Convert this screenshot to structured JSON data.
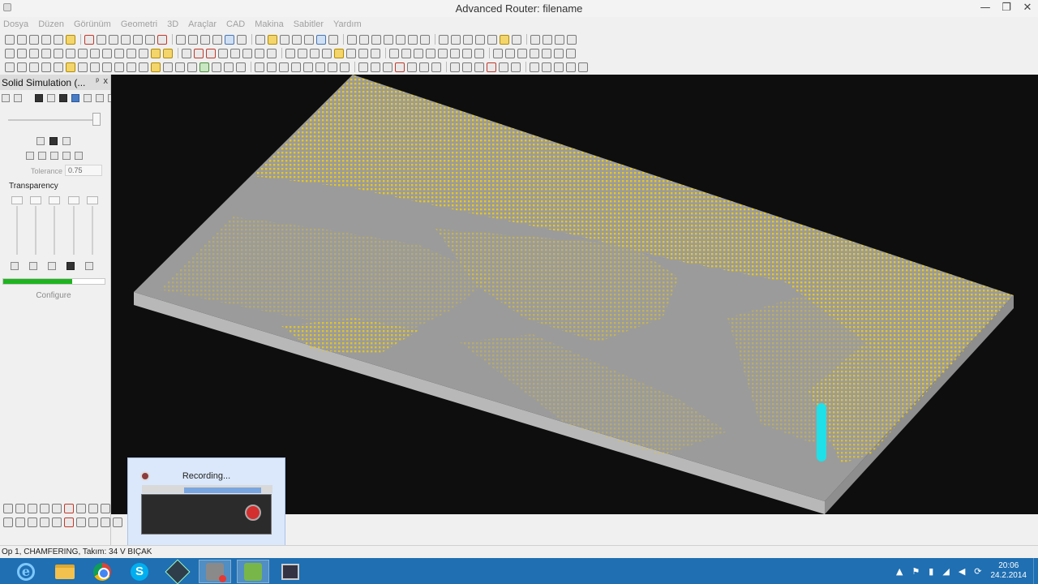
{
  "window": {
    "title": "Advanced Router: filename",
    "controls": {
      "minimize": "—",
      "restore": "❐",
      "close": "✕"
    }
  },
  "menu": [
    "Dosya",
    "Düzen",
    "Görünüm",
    "Geometri",
    "3D",
    "Araçlar",
    "CAD",
    "Makina",
    "Sabitler",
    "Yardım"
  ],
  "panel": {
    "title": "Solid Simulation (...",
    "pin": "ᵖ",
    "close": "x",
    "tolerance_label": "Tolerance",
    "tolerance_value": "0.75",
    "transparency_label": "Transparency",
    "progress_fraction": 0.68,
    "configure_label": "Configure"
  },
  "recording": {
    "label": "Recording..."
  },
  "status": {
    "text": "Op 1, CHAMFERING, Takım: 34 V BIÇAK"
  },
  "taskbar": {
    "clock_time": "20:06",
    "clock_date": "24.2.2014",
    "items": [
      "internet-explorer",
      "file-explorer",
      "chrome",
      "skype",
      "app",
      "advanced-router",
      "green-app",
      "network-app"
    ]
  },
  "colors": {
    "titlebar": "#f3f3f3",
    "viewport_bg": "#0e0e0e",
    "material_gray": "#9b9b9b",
    "engrave_yellow": "#e8c81a",
    "tool_cyan": "#1fe0e8",
    "taskbar": "#1f6fb2",
    "progress_green": "#1fb41f"
  }
}
